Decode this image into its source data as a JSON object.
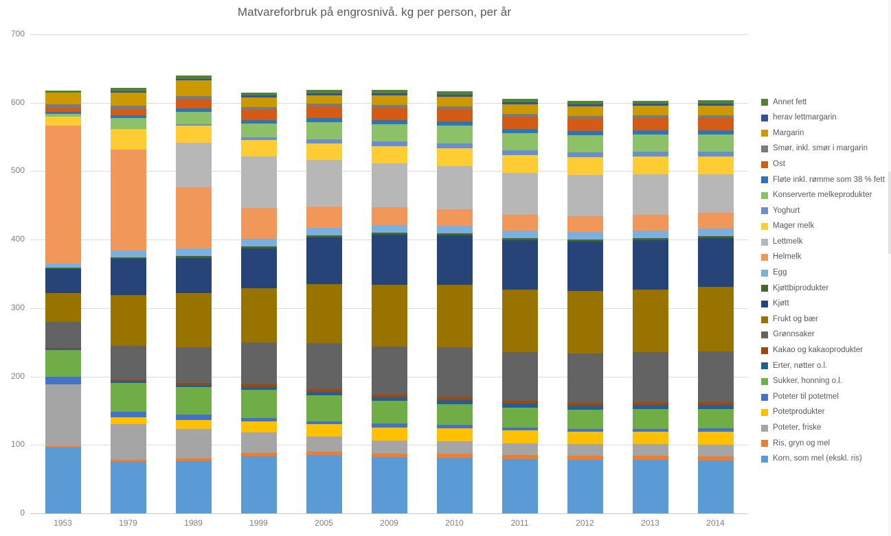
{
  "chart_data": {
    "type": "bar",
    "stacked": true,
    "title": "Matvareforbruk på engrosnivå. kg per person, per år",
    "xlabel": "",
    "ylabel": "",
    "ylim": [
      0,
      700
    ],
    "yticks": [
      0,
      100,
      200,
      300,
      400,
      500,
      600,
      700
    ],
    "grid": true,
    "legend_position": "right",
    "categories": [
      "1953",
      "1979",
      "1989",
      "1999",
      "2005",
      "2009",
      "2010",
      "2011",
      "2012",
      "2013",
      "2014"
    ],
    "series": [
      {
        "name": "Korn, som mel (ekskl. ris)",
        "color": "#5b9bd5",
        "values": [
          96,
          75,
          76,
          83,
          85,
          82,
          81,
          79,
          78,
          78,
          77
        ]
      },
      {
        "name": "Ris, gryn og mel",
        "color": "#ed7d31",
        "values": [
          2,
          3,
          4,
          5,
          5,
          5,
          6,
          6,
          6,
          6,
          6
        ]
      },
      {
        "name": "Poteter, friske",
        "color": "#a5a5a5",
        "values": [
          91,
          52,
          43,
          30,
          22,
          19,
          18,
          17,
          17,
          17,
          17
        ]
      },
      {
        "name": "Potetprodukter",
        "color": "#ffc000",
        "values": [
          0,
          10,
          13,
          16,
          18,
          19,
          19,
          19,
          18,
          18,
          19
        ]
      },
      {
        "name": "Poteter til potetmel",
        "color": "#4472c4",
        "values": [
          11,
          8,
          8,
          5,
          4,
          6,
          5,
          4,
          4,
          4,
          5
        ]
      },
      {
        "name": "Sukker, honning o.l.",
        "color": "#70ad47",
        "values": [
          39,
          43,
          41,
          42,
          39,
          34,
          31,
          30,
          29,
          30,
          29
        ]
      },
      {
        "name": "Erter, nøtter o.l.",
        "color": "#255e91",
        "values": [
          2,
          3,
          3,
          4,
          5,
          5,
          6,
          6,
          6,
          6,
          6
        ]
      },
      {
        "name": "Kakao og kakaoprodukter",
        "color": "#9e480e",
        "values": [
          1,
          2,
          3,
          4,
          4,
          4,
          4,
          4,
          4,
          4,
          4
        ]
      },
      {
        "name": "Grønnsaker",
        "color": "#636363",
        "values": [
          38,
          49,
          52,
          61,
          67,
          70,
          73,
          71,
          72,
          73,
          74
        ]
      },
      {
        "name": "Frukt og bær",
        "color": "#997300",
        "values": [
          42,
          74,
          79,
          79,
          86,
          90,
          91,
          91,
          91,
          91,
          94
        ]
      },
      {
        "name": "Kjøtt",
        "color": "#264478",
        "values": [
          35,
          53,
          51,
          58,
          68,
          73,
          72,
          72,
          72,
          72,
          71
        ]
      },
      {
        "name": "Kjøttbiprodukter",
        "color": "#43682b",
        "values": [
          2,
          2,
          3,
          3,
          3,
          3,
          3,
          3,
          3,
          3,
          3
        ]
      },
      {
        "name": "Egg",
        "color": "#7cafdd",
        "values": [
          6,
          10,
          11,
          11,
          11,
          11,
          11,
          11,
          11,
          11,
          11
        ]
      },
      {
        "name": "Helmelk",
        "color": "#f1975a",
        "values": [
          202,
          148,
          89,
          45,
          31,
          26,
          24,
          23,
          23,
          23,
          23
        ]
      },
      {
        "name": "Lettmelk",
        "color": "#b7b7b7",
        "values": [
          0,
          0,
          66,
          76,
          69,
          65,
          64,
          62,
          61,
          60,
          57
        ]
      },
      {
        "name": "Mager melk",
        "color": "#ffcd33",
        "values": [
          13,
          30,
          25,
          24,
          24,
          25,
          26,
          26,
          26,
          26,
          26
        ]
      },
      {
        "name": "Yoghurt",
        "color": "#698ed0",
        "values": [
          0,
          0,
          2,
          4,
          6,
          7,
          7,
          7,
          7,
          7,
          7
        ]
      },
      {
        "name": "Konserverte melkeprodukter",
        "color": "#8cc168",
        "values": [
          4,
          16,
          18,
          20,
          25,
          25,
          26,
          25,
          25,
          25,
          25
        ]
      },
      {
        "name": "Fløte inkl. rømme som 38 % fett",
        "color": "#2e75b6",
        "values": [
          3,
          4,
          5,
          5,
          6,
          6,
          6,
          6,
          6,
          6,
          6
        ]
      },
      {
        "name": "Ost",
        "color": "#d35b16",
        "values": [
          6,
          9,
          13,
          15,
          17,
          18,
          18,
          18,
          18,
          18,
          18
        ]
      },
      {
        "name": "Smør, inkl. smør i margarin",
        "color": "#7b7b7b",
        "values": [
          5,
          5,
          5,
          4,
          4,
          4,
          4,
          4,
          4,
          4,
          4
        ]
      },
      {
        "name": "Margarin",
        "color": "#cc9a00",
        "values": [
          17,
          19,
          23,
          14,
          12,
          14,
          14,
          14,
          14,
          14,
          14
        ]
      },
      {
        "name": "herav lettmargarin",
        "color": "#2f5597",
        "values": [
          0,
          2,
          2,
          3,
          3,
          3,
          3,
          3,
          3,
          3,
          3
        ]
      },
      {
        "name": "Annet fett",
        "color": "#548235",
        "values": [
          3,
          5,
          5,
          4,
          5,
          5,
          5,
          5,
          5,
          4,
          5
        ]
      }
    ],
    "totals": [
      618,
      639,
      640,
      612,
      622,
      620,
      621,
      617,
      617,
      611,
      613
    ]
  },
  "legend": {
    "items": [
      {
        "label": "Annet fett",
        "color": "#548235"
      },
      {
        "label": "herav lettmargarin",
        "color": "#2f5597"
      },
      {
        "label": "Margarin",
        "color": "#cc9a00"
      },
      {
        "label": "Smør, inkl. smør i margarin",
        "color": "#7b7b7b"
      },
      {
        "label": "Ost",
        "color": "#d35b16"
      },
      {
        "label": "Fløte inkl. rømme som 38 % fett",
        "color": "#2e75b6"
      },
      {
        "label": "Konserverte melkeprodukter",
        "color": "#8cc168"
      },
      {
        "label": "Yoghurt",
        "color": "#698ed0"
      },
      {
        "label": "Mager melk",
        "color": "#ffcd33"
      },
      {
        "label": "Lettmelk",
        "color": "#b7b7b7"
      },
      {
        "label": "Helmelk",
        "color": "#f1975a"
      },
      {
        "label": "Egg",
        "color": "#7cafdd"
      },
      {
        "label": "Kjøttbiprodukter",
        "color": "#43682b"
      },
      {
        "label": "Kjøtt",
        "color": "#264478"
      },
      {
        "label": "Frukt og bær",
        "color": "#997300"
      },
      {
        "label": "Grønnsaker",
        "color": "#636363"
      },
      {
        "label": "Kakao og kakaoprodukter",
        "color": "#9e480e"
      },
      {
        "label": "Erter, nøtter o.l.",
        "color": "#255e91"
      },
      {
        "label": "Sukker, honning o.l.",
        "color": "#70ad47"
      },
      {
        "label": "Poteter til potetmel",
        "color": "#4472c4"
      },
      {
        "label": "Potetprodukter",
        "color": "#ffc000"
      },
      {
        "label": "Poteter, friske",
        "color": "#a5a5a5"
      },
      {
        "label": "Ris, gryn og mel",
        "color": "#ed7d31"
      },
      {
        "label": "Korn, som mel (ekskl. ris)",
        "color": "#5b9bd5"
      }
    ]
  },
  "axis": {
    "y_tick_labels": [
      "700",
      "600",
      "500",
      "400",
      "300",
      "200",
      "100",
      "0"
    ],
    "x_tick_labels": [
      "1953",
      "1979",
      "1989",
      "1999",
      "2005",
      "2009",
      "2010",
      "2011",
      "2012",
      "2013",
      "2014"
    ]
  }
}
